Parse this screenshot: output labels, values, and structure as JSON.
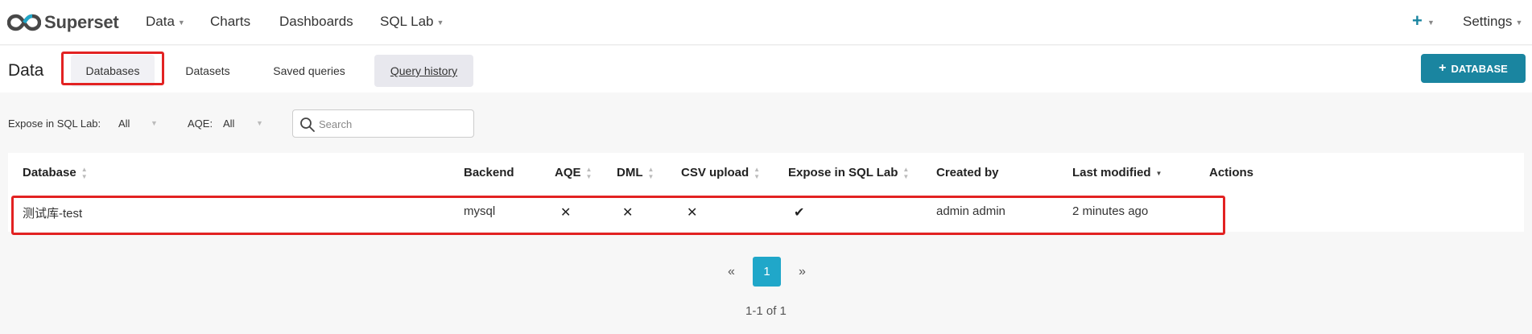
{
  "app": {
    "name": "Superset"
  },
  "nav": {
    "items": [
      {
        "label": "Data",
        "has_caret": true
      },
      {
        "label": "Charts",
        "has_caret": false
      },
      {
        "label": "Dashboards",
        "has_caret": false
      },
      {
        "label": "SQL Lab",
        "has_caret": true
      }
    ],
    "settings_label": "Settings",
    "plus_icon": "plus-icon"
  },
  "subheader": {
    "title": "Data",
    "tabs": [
      {
        "label": "Databases",
        "selected": true
      },
      {
        "label": "Datasets",
        "selected": false
      },
      {
        "label": "Saved queries",
        "selected": false
      },
      {
        "label": "Query history",
        "selected": false
      }
    ],
    "add_button_label": "DATABASE"
  },
  "filters": {
    "expose_label": "Expose in SQL Lab:",
    "expose_value": "All",
    "aqe_label": "AQE:",
    "aqe_value": "All",
    "search_placeholder": "Search"
  },
  "table": {
    "columns": [
      "Database",
      "Backend",
      "AQE",
      "DML",
      "CSV upload",
      "Expose in SQL Lab",
      "Created by",
      "Last modified",
      "Actions"
    ],
    "rows": [
      {
        "database": "测试库-test",
        "backend": "mysql",
        "aqe": "✕",
        "dml": "✕",
        "csv_upload": "✕",
        "expose_in_sql_lab": "✔",
        "created_by": "admin admin",
        "last_modified": "2 minutes ago"
      }
    ]
  },
  "pagination": {
    "prev": "«",
    "current": "1",
    "next": "»",
    "summary": "1-1 of 1"
  },
  "colors": {
    "accent": "#1a85a0",
    "active_page": "#20a7c9",
    "highlight": "#e22222"
  }
}
